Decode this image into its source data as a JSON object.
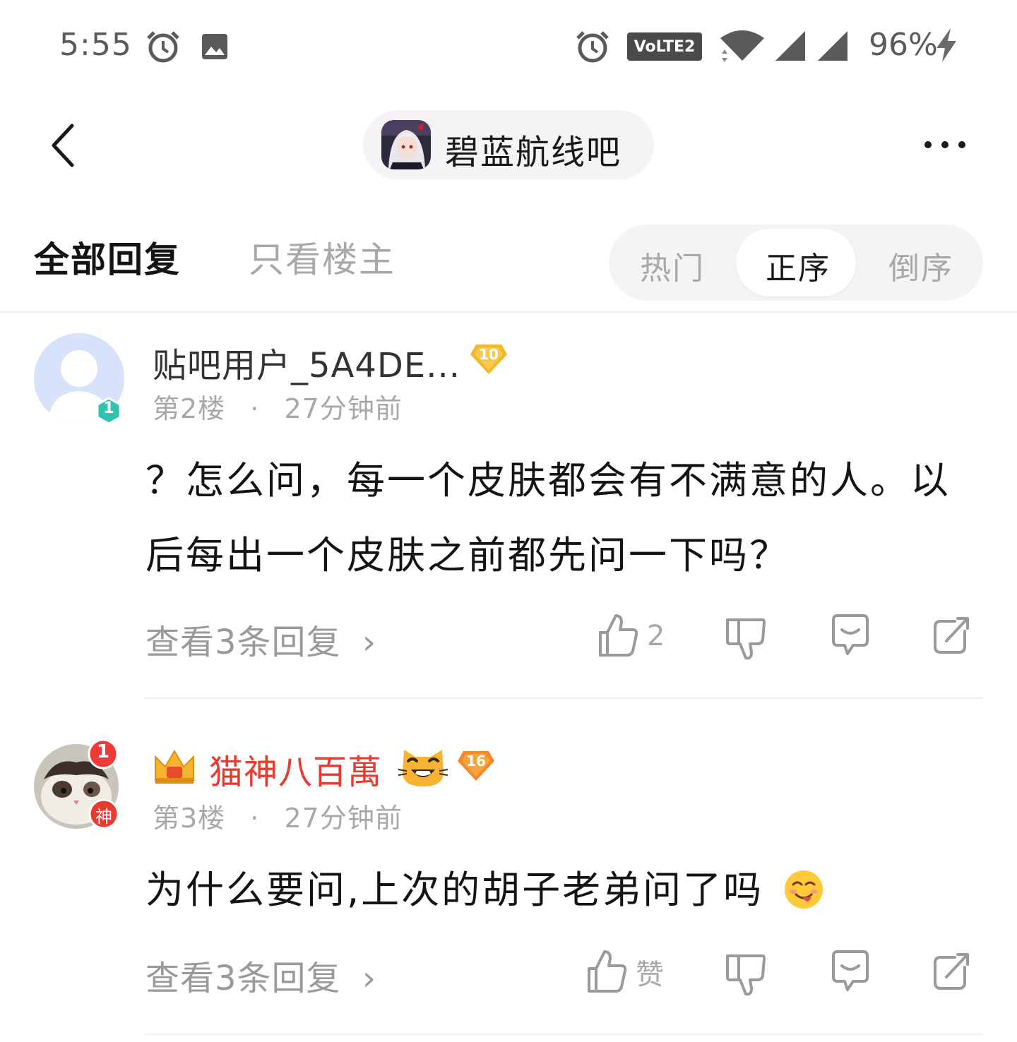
{
  "status_bar": {
    "time": "5:55",
    "volte_label": "VoLTE2",
    "battery": "96%",
    "icons": [
      "alarm-icon",
      "image-icon",
      "alarm-icon",
      "volte-icon",
      "wifi-icon",
      "signal-icon",
      "signal-icon",
      "charging-icon"
    ]
  },
  "header": {
    "forum_name": "碧蓝航线吧"
  },
  "tabs": {
    "all": "全部回复",
    "op_only": "只看楼主"
  },
  "sort": {
    "options": [
      "热门",
      "正序",
      "倒序"
    ],
    "selected": "正序"
  },
  "posts": [
    {
      "user_name": "贴吧用户_5A4DE...",
      "level": "10",
      "avatar_badge": "1",
      "floor": "第2楼",
      "separator": "·",
      "time": "27分钟前",
      "content": "？怎么问，每一个皮肤都会有不满意的人。以后每出一个皮肤之前都先问一下吗？",
      "view_replies": "查看3条回复",
      "like_label": "2"
    },
    {
      "user_name": "猫神八百萬",
      "level": "16",
      "notification_badge": "1",
      "avatar_badge": "神",
      "floor": "第3楼",
      "separator": "·",
      "time": "27分钟前",
      "content": "为什么要问,上次的胡子老弟问了吗",
      "view_replies": "查看3条回复",
      "like_label": "赞"
    }
  ],
  "colors": {
    "accent_red": "#e83b2e",
    "level_orange": "#f7a53b",
    "level_gold": "#f2b72a",
    "badge_teal": "#2ec4b0",
    "muted_text": "#a8a8a8"
  }
}
